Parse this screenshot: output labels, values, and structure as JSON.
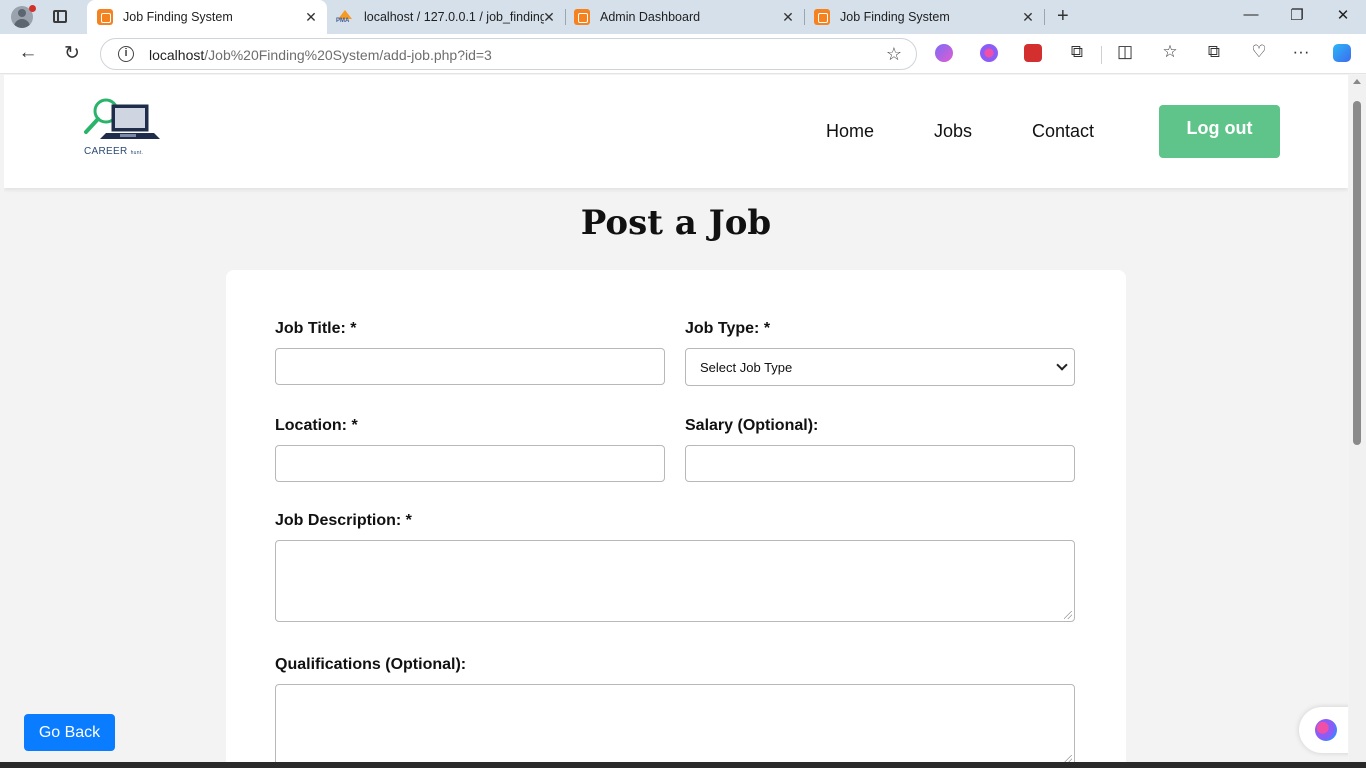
{
  "browser": {
    "tabs": [
      {
        "title": "Job Finding System",
        "active": true
      },
      {
        "title": "localhost / 127.0.0.1 / job_finding",
        "active": false
      },
      {
        "title": "Admin Dashboard",
        "active": false
      },
      {
        "title": "Job Finding System",
        "active": false
      }
    ],
    "url_host": "localhost",
    "url_path": "/Job%20Finding%20System/add-job.php?id=3"
  },
  "header": {
    "logo_text": "CAREER",
    "logo_subtext": "hunt.",
    "nav": [
      "Home",
      "Jobs",
      "Contact"
    ],
    "logout_label": "Log out"
  },
  "page": {
    "title": "Post a Job"
  },
  "form": {
    "job_title_label": "Job Title: *",
    "job_type_label": "Job Type: *",
    "job_type_selected": "Select Job Type",
    "location_label": "Location: *",
    "salary_label": "Salary (Optional):",
    "description_label": "Job Description: *",
    "qualifications_label": "Qualifications (Optional):"
  },
  "footer": {
    "go_back_label": "Go Back"
  },
  "colors": {
    "accent_green": "#5ec48a",
    "go_back_blue": "#0a7cff"
  }
}
